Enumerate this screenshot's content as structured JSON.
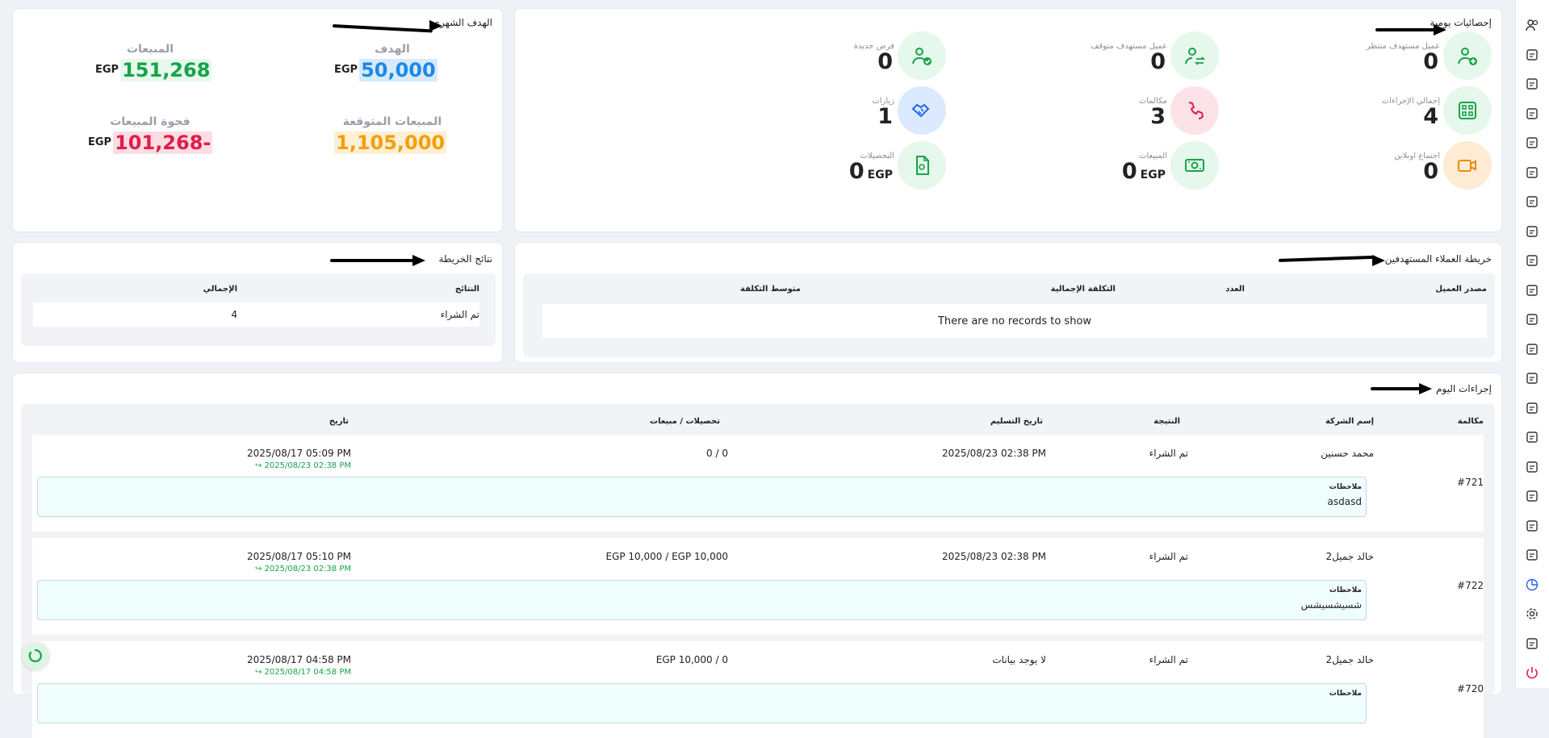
{
  "daily_stats": {
    "title": "إحصائيات يومية",
    "items": [
      {
        "label": "عميل مستهدف منتظر",
        "value": "0",
        "icon": "user-plus-icon",
        "color": "#16a34a",
        "bg": "#e6f7ec"
      },
      {
        "label": "عميل مستهدف متوقف",
        "value": "0",
        "icon": "users-swap-icon",
        "color": "#16a34a",
        "bg": "#e6f7ec"
      },
      {
        "label": "فرص جديدة",
        "value": "0",
        "icon": "users-check-icon",
        "color": "#16a34a",
        "bg": "#e6f7ec"
      },
      {
        "label": "إجمالي الإجراءات",
        "value": "4",
        "icon": "grid-icon",
        "color": "#16a34a",
        "bg": "#e6f7ec"
      },
      {
        "label": "مكالمات",
        "value": "3",
        "icon": "phone-icon",
        "color": "#e11d48",
        "bg": "#fde2e7"
      },
      {
        "label": "زيارات",
        "value": "1",
        "icon": "handshake-icon",
        "color": "#2563eb",
        "bg": "#dbeafe"
      },
      {
        "label": "اجتماع اونلاين",
        "value": "0",
        "icon": "video-icon",
        "color": "#ea8a0c",
        "bg": "#fdebd3"
      },
      {
        "label": "المبيعات",
        "value": "0",
        "currency": "EGP",
        "icon": "money-icon",
        "color": "#16a34a",
        "bg": "#e6f7ec"
      },
      {
        "label": "التحصيلات",
        "value": "0",
        "currency": "EGP",
        "icon": "receipt-icon",
        "color": "#16a34a",
        "bg": "#e6f7ec"
      }
    ]
  },
  "monthly_goal": {
    "title": "الهدف الشهري",
    "target": {
      "label": "الهدف",
      "currency": "EGP",
      "value": "50,000",
      "color": "#1e88e5",
      "bg": "#d6eafc"
    },
    "sales": {
      "label": "المبيعات",
      "currency": "EGP",
      "value": "151,268",
      "color": "#16a34a",
      "bg": "#e7f8ec"
    },
    "expected": {
      "label": "المبيعات المتوقعة",
      "value": "1,105,000",
      "color": "#f59e0b",
      "bg": "#fdf0d5"
    },
    "gap": {
      "label": "فجوة المبيعات",
      "currency": "EGP",
      "value": "101,268-",
      "color": "#e11d48",
      "bg": "#fcdde3"
    }
  },
  "target_map": {
    "title": "خريطة العملاء المستهدفين",
    "columns": [
      "مصدر العميل",
      "العدد",
      "التكلفة الإجمالية",
      "متوسط التكلفة"
    ],
    "empty_text": "There are no records to show"
  },
  "map_results": {
    "title": "نتائج الخريطة",
    "columns": [
      "النتائج",
      "الإجمالي"
    ],
    "rows": [
      [
        "تم الشراء",
        "4"
      ]
    ]
  },
  "today_actions": {
    "title": "إجراءات اليوم",
    "columns": [
      "مكالمة",
      "إسم الشركة",
      "النتيجة",
      "تاريخ التسليم",
      "تحصيلات / مبيعات",
      "تاريخ"
    ],
    "note_label": "ملاحظات",
    "rows": [
      {
        "id": "#721",
        "company": "محمد حسنين",
        "result": "تم الشراء",
        "delivery": "2025/08/23 02:38 PM",
        "amounts": "0 / 0",
        "date": "2025/08/17 05:09 PM",
        "date_sub": "↪ 2025/08/23 02:38 PM",
        "note": "asdasd"
      },
      {
        "id": "#722",
        "company": "خالد جميل2",
        "result": "تم الشراء",
        "delivery": "2025/08/23 02:38 PM",
        "amounts": "EGP 10,000 / EGP 10,000",
        "date": "2025/08/17 05:10 PM",
        "date_sub": "↪ 2025/08/23 02:38 PM",
        "note": "شسيشسيشس"
      },
      {
        "id": "#720",
        "company": "خالد جميل2",
        "result": "تم الشراء",
        "delivery": "لا يوجد بيانات",
        "amounts": "EGP 10,000 / 0",
        "date": "2025/08/17 04:58 PM",
        "date_sub": "↪ 2025/08/17 04:58 PM",
        "note": ""
      }
    ]
  },
  "sidebar": {
    "icons": [
      "users-icon",
      "document-icon",
      "receipt-icon",
      "phone-icon",
      "target-icon",
      "telephone-icon",
      "car-icon",
      "people-group-icon",
      "cash-icon",
      "alert-icon",
      "recycle-icon",
      "warning-icon",
      "invoice-icon",
      "pen-icon",
      "truck-icon",
      "box-icon",
      "user-icon",
      "user-lock-icon",
      "file-chart-icon",
      "chart-icon",
      "gear-icon",
      "window-icon",
      "power-icon"
    ]
  }
}
